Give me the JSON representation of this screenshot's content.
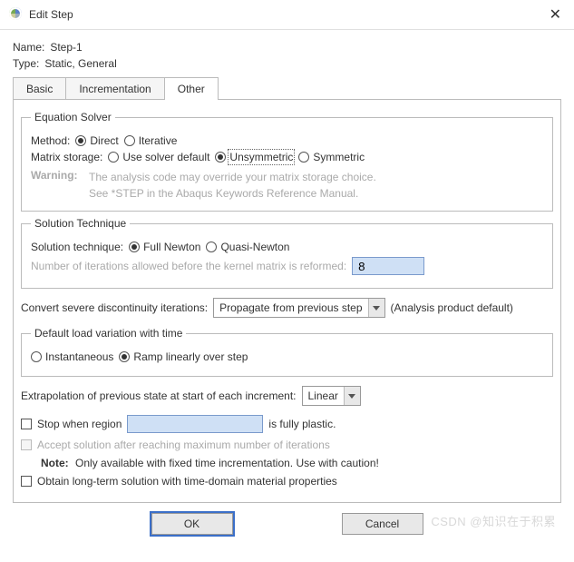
{
  "titlebar": {
    "title": "Edit Step"
  },
  "header": {
    "name_label": "Name:",
    "name_value": "Step-1",
    "type_label": "Type:",
    "type_value": "Static, General"
  },
  "tabs": {
    "basic": "Basic",
    "incrementation": "Incrementation",
    "other": "Other"
  },
  "solver": {
    "legend": "Equation Solver",
    "method_label": "Method:",
    "method_direct": "Direct",
    "method_iterative": "Iterative",
    "storage_label": "Matrix storage:",
    "storage_default": "Use solver default",
    "storage_unsymmetric": "Unsymmetric",
    "storage_symmetric": "Symmetric",
    "warning_label": "Warning:",
    "warning_text": "The analysis code may override your matrix storage choice.\nSee *STEP in the Abaqus Keywords Reference Manual."
  },
  "technique": {
    "legend": "Solution Technique",
    "label": "Solution technique:",
    "full_newton": "Full Newton",
    "quasi_newton": "Quasi-Newton",
    "iter_label": "Number of iterations allowed before the kernel matrix is reformed:",
    "iter_value": "8"
  },
  "convert": {
    "label": "Convert severe discontinuity iterations:",
    "selected": "Propagate from previous step",
    "suffix": "(Analysis product default)"
  },
  "load_variation": {
    "legend": "Default load variation with time",
    "instant": "Instantaneous",
    "ramp": "Ramp linearly over step"
  },
  "extrapolation": {
    "label": "Extrapolation of previous state at start of each increment:",
    "selected": "Linear"
  },
  "stop_region": {
    "prefix": "Stop when region",
    "value": "",
    "suffix": "is fully plastic."
  },
  "accept_max_iter": "Accept solution after reaching maximum number of iterations",
  "note": {
    "label": "Note:",
    "text": "Only available with fixed time incrementation. Use with caution!"
  },
  "obtain_longterm": "Obtain long-term solution with time-domain material properties",
  "buttons": {
    "ok": "OK",
    "cancel": "Cancel"
  },
  "watermark": "CSDN @知识在于积累"
}
